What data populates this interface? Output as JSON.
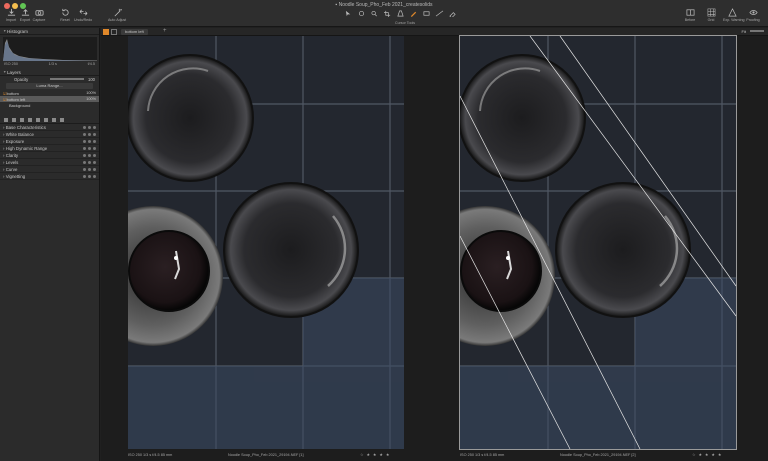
{
  "window": {
    "title": "Noodle Soup_Pho_Feb 2021_createsolids"
  },
  "toolbar": {
    "left": [
      {
        "label": "Import",
        "icon": "import-icon"
      },
      {
        "label": "Export",
        "icon": "export-icon"
      },
      {
        "label": "Capture",
        "icon": "camera-icon"
      },
      {
        "label": "Reset",
        "icon": "reset-icon"
      },
      {
        "label": "Undo/Redo",
        "icon": "undo-redo-icon"
      },
      {
        "label": "Auto Adjust",
        "icon": "wand-icon"
      }
    ],
    "cursor_tools_label": "Cursor Tools",
    "right": [
      {
        "label": "Before",
        "icon": "before-icon"
      },
      {
        "label": "Grid",
        "icon": "grid-icon"
      },
      {
        "label": "Exp. Warning",
        "icon": "warning-icon"
      },
      {
        "label": "Proofing",
        "icon": "proofing-icon"
      }
    ]
  },
  "sidebar": {
    "histogram": {
      "title": "Histogram",
      "iso": "ISO 250",
      "shutter": "1/3 s",
      "aperture": "f/4.5"
    },
    "layers": {
      "title": "Layers",
      "opacity_label": "Opacity",
      "opacity_value": "100",
      "luma_button": "Luma Range...",
      "items": [
        {
          "name": "bottom",
          "value": "100%"
        },
        {
          "name": "bottom left",
          "value": "100%"
        },
        {
          "name": "Background",
          "value": ""
        }
      ]
    },
    "adjustments": [
      "Base Characteristics",
      "White Balance",
      "Exposure",
      "High Dynamic Range",
      "Clarity",
      "Levels",
      "Curve",
      "Vignetting"
    ]
  },
  "viewer": {
    "tab_label": "bottom left",
    "zoom_label": "Fit",
    "left_caption": {
      "meta": "ISO 250   1/3 s   f/4.5   85 mm",
      "filename": "Noodle Soup_Pho_Feb 2021_29194.NEF [1]"
    },
    "right_caption": {
      "meta": "ISO 250   1/3 s   f/4.5   85 mm",
      "filename": "Noodle Soup_Pho_Feb 2021_29194.NEF [2]"
    },
    "stars": "☆ ★ ★ ★ ★"
  },
  "colors": {
    "accent": "#e0882a",
    "panel": "#2b2b2b",
    "selected_layer": "#5a5a5a"
  }
}
